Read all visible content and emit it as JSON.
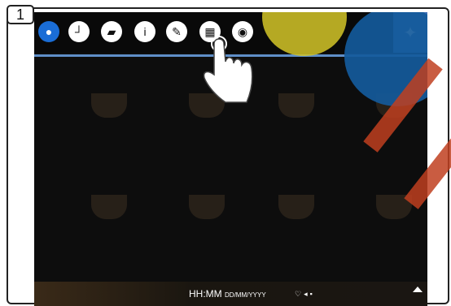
{
  "step": {
    "number": "1"
  },
  "toolbar": {
    "icons": [
      "water-drop-icon",
      "clock-icon",
      "flag-icon",
      "info-icon",
      "pencil-icon",
      "calendar-icon",
      "user-icon"
    ],
    "settings_icon": "wrench-icon"
  },
  "status_bar": {
    "time": "HH:MM",
    "date": "DD/MM/YYYY"
  },
  "colors": {
    "accent_blue": "#3e6fb5",
    "highlight_yellow": "#d4c628",
    "highlight_blue": "#145a9b",
    "stripe_red": "#c04020"
  }
}
